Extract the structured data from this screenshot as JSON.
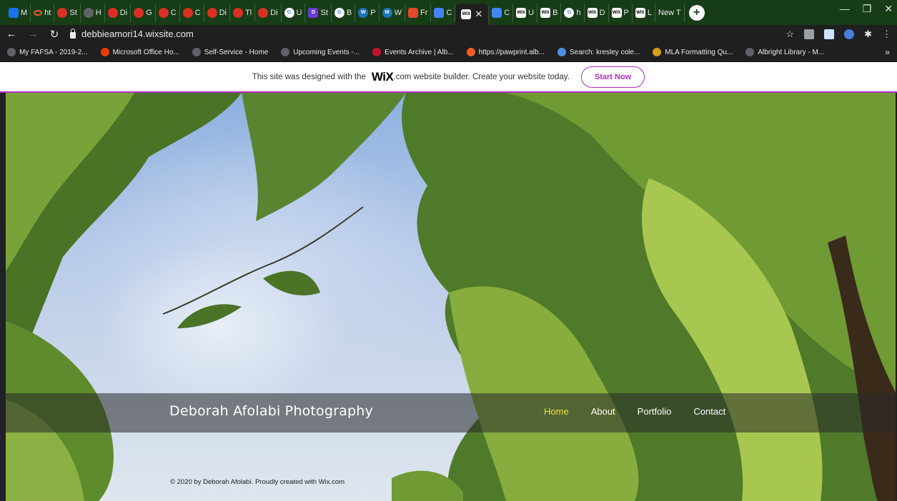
{
  "browser": {
    "tabs": [
      {
        "label": "M",
        "icon": "outlook-icon",
        "cls": "fav-outlook"
      },
      {
        "label": "ht",
        "icon": "pawprint-icon",
        "cls": "fav-pawprint"
      },
      {
        "label": "St",
        "icon": "gear-icon",
        "cls": "fav-gear"
      },
      {
        "label": "H",
        "icon": "dark-favicon-icon",
        "cls": "fav-dark"
      },
      {
        "label": "Di",
        "icon": "gear-icon",
        "cls": "fav-gear"
      },
      {
        "label": "G",
        "icon": "gear-icon",
        "cls": "fav-gear"
      },
      {
        "label": "C",
        "icon": "gear-icon",
        "cls": "fav-gear"
      },
      {
        "label": "C",
        "icon": "gear-icon",
        "cls": "fav-gear"
      },
      {
        "label": "Di",
        "icon": "gear-icon",
        "cls": "fav-gear"
      },
      {
        "label": "Tl",
        "icon": "gear-icon",
        "cls": "fav-gear"
      },
      {
        "label": "Di",
        "icon": "gear-icon",
        "cls": "fav-gear"
      },
      {
        "label": "U",
        "icon": "google-icon",
        "cls": "fav-google"
      },
      {
        "label": "St",
        "icon": "d-app-icon",
        "cls": "fav-d"
      },
      {
        "label": "B",
        "icon": "google-icon",
        "cls": "fav-google"
      },
      {
        "label": "P",
        "icon": "wordpress-icon",
        "cls": "fav-wp"
      },
      {
        "label": "W",
        "icon": "wordpress-icon",
        "cls": "fav-wp"
      },
      {
        "label": "Fr",
        "icon": "fr-app-icon",
        "cls": "fav-fr"
      },
      {
        "label": "C",
        "icon": "google-docs-icon",
        "cls": "fav-docs"
      }
    ],
    "active_tab": {
      "icon": "wix-icon"
    },
    "tabs_after": [
      {
        "label": "C",
        "icon": "google-docs-icon",
        "cls": "fav-docs"
      },
      {
        "label": "U",
        "icon": "wix-icon",
        "cls": "fav-wix"
      },
      {
        "label": "B",
        "icon": "wix-icon",
        "cls": "fav-wix"
      },
      {
        "label": "h",
        "icon": "google-icon",
        "cls": "fav-google"
      },
      {
        "label": "D",
        "icon": "wix-icon",
        "cls": "fav-wix"
      },
      {
        "label": "P",
        "icon": "wix-icon",
        "cls": "fav-wix"
      },
      {
        "label": "L",
        "icon": "wix-icon",
        "cls": "fav-wix"
      },
      {
        "label": "New T",
        "icon": "none",
        "cls": ""
      }
    ],
    "address": "debbieamori14.wixsite.com",
    "bookmarks": [
      {
        "label": "My FAFSA - 2019-2...",
        "color": "#5f6368"
      },
      {
        "label": "Microsoft Office Ho...",
        "color": "#eb3c00"
      },
      {
        "label": "Self-Service - Home",
        "color": "#5f6368"
      },
      {
        "label": "Upcoming Events -...",
        "color": "#5f6368"
      },
      {
        "label": "Events Archive | Alb...",
        "color": "#c8102e"
      },
      {
        "label": "https://pawprint.alb...",
        "color": "#f25d22"
      },
      {
        "label": "Search: kresley cole...",
        "color": "#4a90e2"
      },
      {
        "label": "MLA Formatting Qu...",
        "color": "#d4a017"
      },
      {
        "label": "Albright Library - M...",
        "color": "#5f6368"
      }
    ],
    "bookmarks_more": "»"
  },
  "wix_banner": {
    "text_before": "This site was designed with the",
    "logo": "WiX",
    "text_after": ".com website builder. Create your website today.",
    "button": "Start Now"
  },
  "site": {
    "title": "Deborah Afolabi Photography",
    "nav": [
      {
        "label": "Home",
        "active": true
      },
      {
        "label": "About",
        "active": false
      },
      {
        "label": "Portfolio",
        "active": false
      },
      {
        "label": "Contact",
        "active": false
      }
    ],
    "footer": "© 2020 by Deborah Afolabi. Proudly created with Wix.com"
  },
  "colors": {
    "accent": "#b12fc4",
    "nav_active": "#f2e330",
    "tabstrip": "#173d17"
  }
}
